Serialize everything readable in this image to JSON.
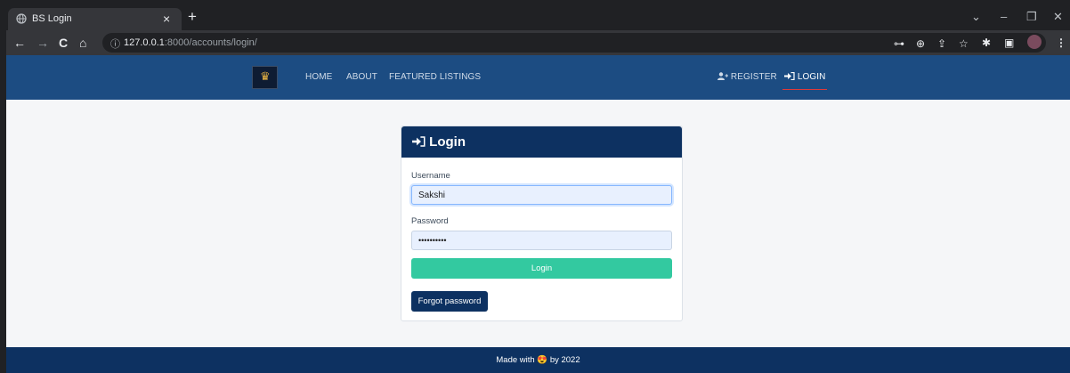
{
  "browser": {
    "tab_title": "BS Login",
    "tab_close": "×",
    "new_tab": "+",
    "url_host": "127.0.0.1",
    "url_rest": ":8000/accounts/login/",
    "icons": {
      "favicon": "globe-icon",
      "back": "←",
      "forward": "→",
      "reload": "C",
      "home": "⌂",
      "info": "ⓘ",
      "key": "⊶",
      "zoom": "⊕",
      "share": "⇪",
      "star": "☆",
      "extensions": "✱",
      "sidepanel": "▣",
      "menu": "⋮",
      "chevron": "⌄",
      "minimize": "–",
      "restore": "❐",
      "close": "✕"
    }
  },
  "navbar": {
    "links": [
      "HOME",
      "ABOUT",
      "FEATURED LISTINGS"
    ],
    "register_label": "REGISTER",
    "register_icon": "user-plus-icon",
    "login_label": "LOGIN",
    "login_icon": "sign-in-icon",
    "active": "LOGIN",
    "accent_color": "#e03a3a",
    "bg_color": "#1c4c82"
  },
  "login_card": {
    "title": "Login",
    "title_icon": "sign-in-icon",
    "username_label": "Username",
    "username_value": "Sakshi",
    "password_label": "Password",
    "password_value": "••••••••••",
    "login_button": "Login",
    "forgot_button": "Forgot password",
    "header_color": "#0d3161",
    "button_color": "#33c9a0"
  },
  "footer": {
    "text_before": "Made with",
    "emoji": "😍",
    "text_after": "by 2022"
  }
}
